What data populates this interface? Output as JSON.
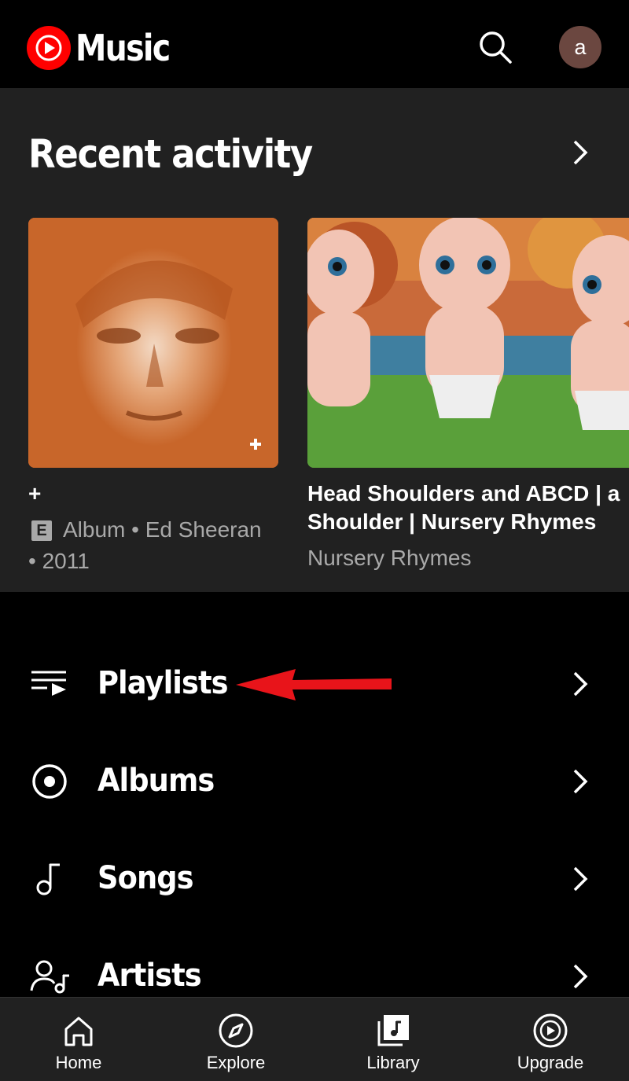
{
  "app": {
    "name": "Music"
  },
  "header": {
    "avatar_letter": "a"
  },
  "recent": {
    "title": "Recent activity",
    "items": [
      {
        "title": "+",
        "explicit_badge": "E",
        "subtitle_line1": "Album • Ed Sheeran",
        "subtitle_line2": "• 2011"
      },
      {
        "title_line1": "Head Shoulders and ABCD | a",
        "title_line2": "Shoulder | Nursery Rhymes",
        "subtitle": "Nursery Rhymes"
      }
    ]
  },
  "library": {
    "items": [
      {
        "label": "Playlists",
        "icon": "playlist-icon"
      },
      {
        "label": "Albums",
        "icon": "album-icon"
      },
      {
        "label": "Songs",
        "icon": "music-note-icon"
      },
      {
        "label": "Artists",
        "icon": "artist-icon"
      }
    ]
  },
  "bottom_nav": {
    "items": [
      {
        "label": "Home",
        "icon": "home-icon"
      },
      {
        "label": "Explore",
        "icon": "compass-icon"
      },
      {
        "label": "Library",
        "icon": "library-icon",
        "active": true
      },
      {
        "label": "Upgrade",
        "icon": "upgrade-icon"
      }
    ]
  },
  "colors": {
    "brand_red": "#ff0000",
    "annotation_red": "#e8141a",
    "panel": "#212121",
    "background": "#000000"
  }
}
